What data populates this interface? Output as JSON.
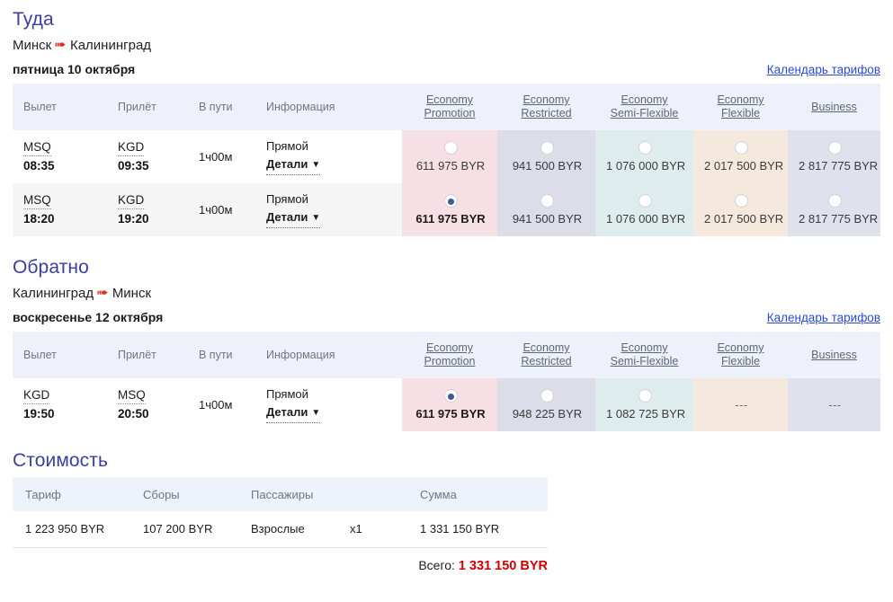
{
  "outbound": {
    "title": "Туда",
    "from": "Минск",
    "to": "Калининград",
    "plane_icon": "airplane-right-icon",
    "date": "пятница 10 октября",
    "calendar_link": "Календарь тарифов",
    "columns": [
      "Вылет",
      "Прилёт",
      "В пути",
      "Информация"
    ],
    "fare_classes": [
      {
        "line1": "Economy",
        "line2": "Promotion"
      },
      {
        "line1": "Economy",
        "line2": "Restricted"
      },
      {
        "line1": "Economy",
        "line2": "Semi-Flexible"
      },
      {
        "line1": "Economy",
        "line2": "Flexible"
      },
      {
        "line1": "Business",
        "line2": ""
      }
    ],
    "rows": [
      {
        "dep_code": "MSQ",
        "dep_time": "08:35",
        "arr_code": "KGD",
        "arr_time": "09:35",
        "duration": "1ч00м",
        "info": "Прямой",
        "details": "Детали",
        "fares": [
          {
            "price": "611 975 BYR",
            "selected": false
          },
          {
            "price": "941 500 BYR",
            "selected": false
          },
          {
            "price": "1 076 000 BYR",
            "selected": false
          },
          {
            "price": "2 017 500 BYR",
            "selected": false
          },
          {
            "price": "2 817 775 BYR",
            "selected": false
          }
        ]
      },
      {
        "dep_code": "MSQ",
        "dep_time": "18:20",
        "arr_code": "KGD",
        "arr_time": "19:20",
        "duration": "1ч00м",
        "info": "Прямой",
        "details": "Детали",
        "fares": [
          {
            "price": "611 975 BYR",
            "selected": true
          },
          {
            "price": "941 500 BYR",
            "selected": false
          },
          {
            "price": "1 076 000 BYR",
            "selected": false
          },
          {
            "price": "2 017 500 BYR",
            "selected": false
          },
          {
            "price": "2 817 775 BYR",
            "selected": false
          }
        ]
      }
    ]
  },
  "inbound": {
    "title": "Обратно",
    "from": "Калининград",
    "to": "Минск",
    "plane_icon": "airplane-right-icon",
    "date": "воскресенье 12 октября",
    "calendar_link": "Календарь тарифов",
    "columns": [
      "Вылет",
      "Прилёт",
      "В пути",
      "Информация"
    ],
    "fare_classes": [
      {
        "line1": "Economy",
        "line2": "Promotion"
      },
      {
        "line1": "Economy",
        "line2": "Restricted"
      },
      {
        "line1": "Economy",
        "line2": "Semi-Flexible"
      },
      {
        "line1": "Economy",
        "line2": "Flexible"
      },
      {
        "line1": "Business",
        "line2": ""
      }
    ],
    "rows": [
      {
        "dep_code": "KGD",
        "dep_time": "19:50",
        "arr_code": "MSQ",
        "arr_time": "20:50",
        "duration": "1ч00м",
        "info": "Прямой",
        "details": "Детали",
        "fares": [
          {
            "price": "611 975 BYR",
            "selected": true
          },
          {
            "price": "948 225 BYR",
            "selected": false
          },
          {
            "price": "1 082 725 BYR",
            "selected": false
          },
          {
            "price": "---",
            "selected": null
          },
          {
            "price": "---",
            "selected": null
          }
        ]
      }
    ]
  },
  "cost": {
    "title": "Стоимость",
    "columns": [
      "Тариф",
      "Сборы",
      "Пассажиры",
      "",
      "Сумма"
    ],
    "rows": [
      {
        "fare": "1 223 950 BYR",
        "taxes": "107 200 BYR",
        "pax_type": "Взрослые",
        "pax_count": "x1",
        "sum": "1 331 150 BYR"
      }
    ],
    "total_label": "Всего:",
    "total_value": "1 331 150 BYR"
  },
  "colors": {
    "heading": "#3b3f9e",
    "link": "#2b49d6",
    "total": "#cc0000",
    "plane": "#d8322a",
    "promotion_bg": "#f6e0e6",
    "restricted_bg": "#dcdde8",
    "semi_flexible_bg": "#dfeced",
    "flexible_bg": "#f5e8dd",
    "business_bg": "#dfe1ec"
  }
}
